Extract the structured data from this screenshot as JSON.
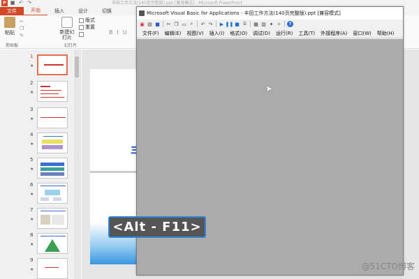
{
  "ppt": {
    "app_icon_label": "P",
    "title": "丰田工作方法(140页完整版).ppt [兼容模式] - Microsoft PowerPoint",
    "tabs": [
      "文件",
      "开始",
      "插入",
      "设计",
      "切换"
    ],
    "active_tab": "开始",
    "ribbon": {
      "paste_label": "粘贴",
      "clipboard_group": "剪贴板",
      "new_slide_label": "新建幻灯片",
      "new_slide_dropdown": "▾",
      "layout_label": "版式",
      "reset_label": "重置",
      "slides_group": "幻灯片"
    },
    "thumbnails": [
      {
        "num": "1",
        "active": true
      },
      {
        "num": "2",
        "active": false
      },
      {
        "num": "3",
        "active": false
      },
      {
        "num": "4",
        "active": false
      },
      {
        "num": "5",
        "active": false
      },
      {
        "num": "6",
        "active": false
      },
      {
        "num": "7",
        "active": false
      },
      {
        "num": "8",
        "active": false
      },
      {
        "num": "9",
        "active": false
      }
    ],
    "slide_char": "丰"
  },
  "vba": {
    "title": "Microsoft Visual Basic for Applications - 丰田工作方法(140页完整版).ppt [兼容模式]",
    "menu": [
      "文件(F)",
      "编辑(E)",
      "视图(V)",
      "插入(I)",
      "格式(O)",
      "调试(D)",
      "运行(R)",
      "工具(T)",
      "外接程序(A)",
      "窗口(W)",
      "帮助(H)"
    ],
    "client_bg": "#ababab"
  },
  "shortcut_label": "<Alt - F11>",
  "watermark": "@51CTO博客",
  "colors": {
    "ppt_accent": "#d24726",
    "shortcut_border": "#2f86d8"
  }
}
